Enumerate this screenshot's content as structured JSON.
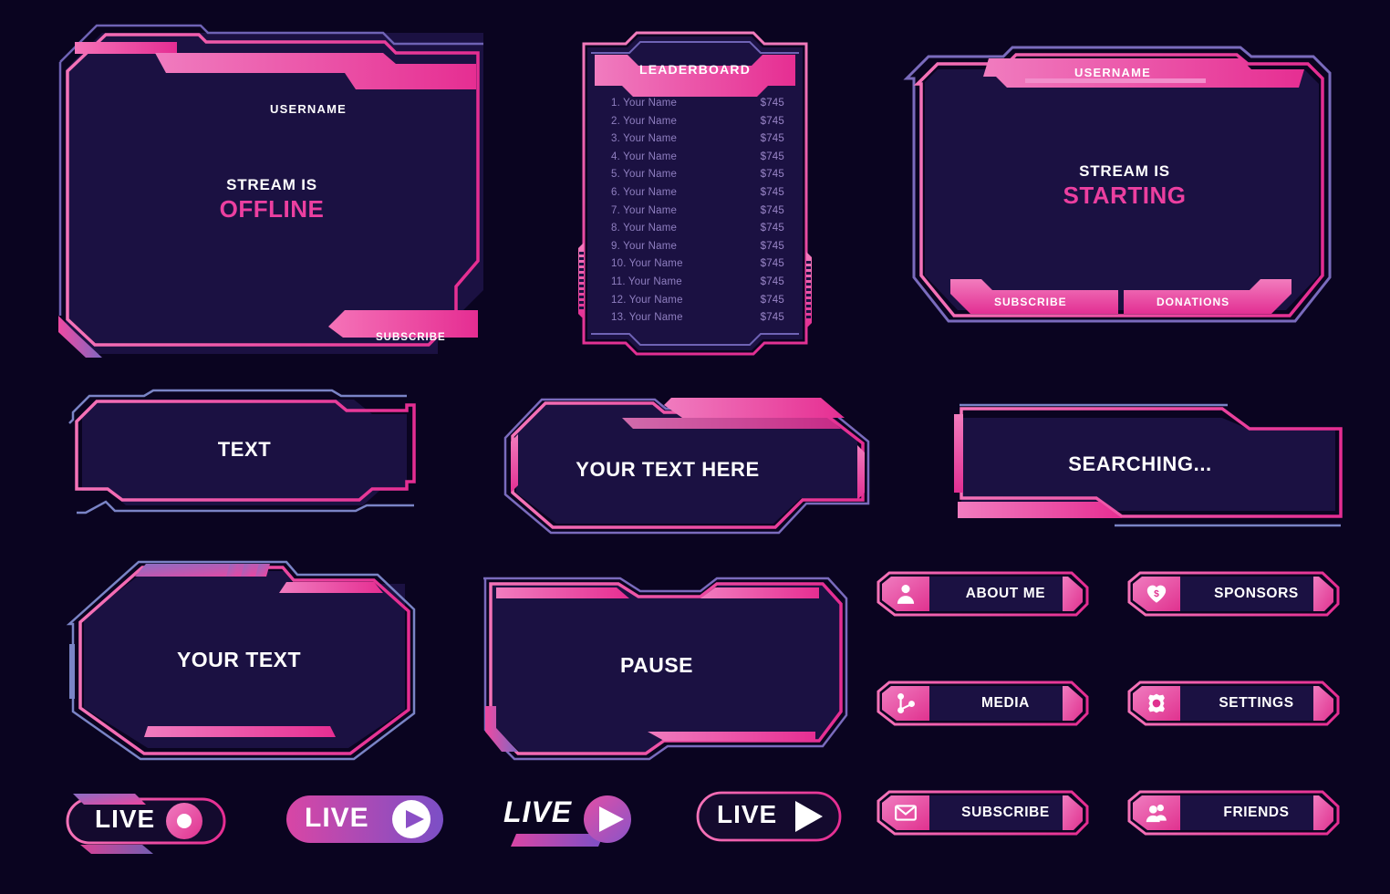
{
  "palette": {
    "background": "#0a0420",
    "panel_fill": "#1b1142",
    "accent_pink": "#ec3fa0",
    "accent_magenta": "#e0479f",
    "accent_violet": "#7b6bbd",
    "accent_light_pink": "#f06bb4",
    "text_muted": "#8f7fc0"
  },
  "panels": {
    "offline": {
      "username": "USERNAME",
      "status_line1": "STREAM IS",
      "status_line2": "OFFLINE",
      "subscribe": "SUBSCRIBE"
    },
    "leaderboard": {
      "title": "LEADERBOARD",
      "rows": [
        {
          "name": "1. Your Name",
          "amount": "$745"
        },
        {
          "name": "2. Your Name",
          "amount": "$745"
        },
        {
          "name": "3. Your Name",
          "amount": "$745"
        },
        {
          "name": "4. Your Name",
          "amount": "$745"
        },
        {
          "name": "5. Your Name",
          "amount": "$745"
        },
        {
          "name": "6. Your Name",
          "amount": "$745"
        },
        {
          "name": "7. Your Name",
          "amount": "$745"
        },
        {
          "name": "8. Your Name",
          "amount": "$745"
        },
        {
          "name": "9. Your Name",
          "amount": "$745"
        },
        {
          "name": "10. Your Name",
          "amount": "$745"
        },
        {
          "name": "11. Your Name",
          "amount": "$745"
        },
        {
          "name": "12. Your Name",
          "amount": "$745"
        },
        {
          "name": "13. Your Name",
          "amount": "$745"
        }
      ]
    },
    "starting": {
      "username": "USERNAME",
      "status_line1": "STREAM IS",
      "status_line2": "STARTING",
      "subscribe": "SUBSCRIBE",
      "donations": "DONATIONS"
    },
    "text_box": {
      "label": "TEXT"
    },
    "your_text_here": {
      "label": "YOUR TEXT HERE"
    },
    "searching": {
      "label": "SEARCHING..."
    },
    "your_text": {
      "label": "YOUR TEXT"
    },
    "pause": {
      "label": "PAUSE"
    }
  },
  "live_badges": [
    {
      "id": "live-outline-dot",
      "label": "LIVE",
      "icon": "record-dot-icon"
    },
    {
      "id": "live-pill-solid",
      "label": "LIVE",
      "icon": "play-circle-icon"
    },
    {
      "id": "live-italic-underline",
      "label": "LIVE",
      "icon": "play-circle-icon"
    },
    {
      "id": "live-outline-play",
      "label": "LIVE",
      "icon": "play-triangle-icon"
    }
  ],
  "icon_buttons": [
    {
      "label": "ABOUT ME",
      "icon": "person-icon"
    },
    {
      "label": "SPONSORS",
      "icon": "heart-dollar-icon"
    },
    {
      "label": "MEDIA",
      "icon": "share-network-icon"
    },
    {
      "label": "SETTINGS",
      "icon": "gear-icon"
    },
    {
      "label": "SUBSCRIBE",
      "icon": "envelope-icon"
    },
    {
      "label": "FRIENDS",
      "icon": "people-icon"
    }
  ]
}
